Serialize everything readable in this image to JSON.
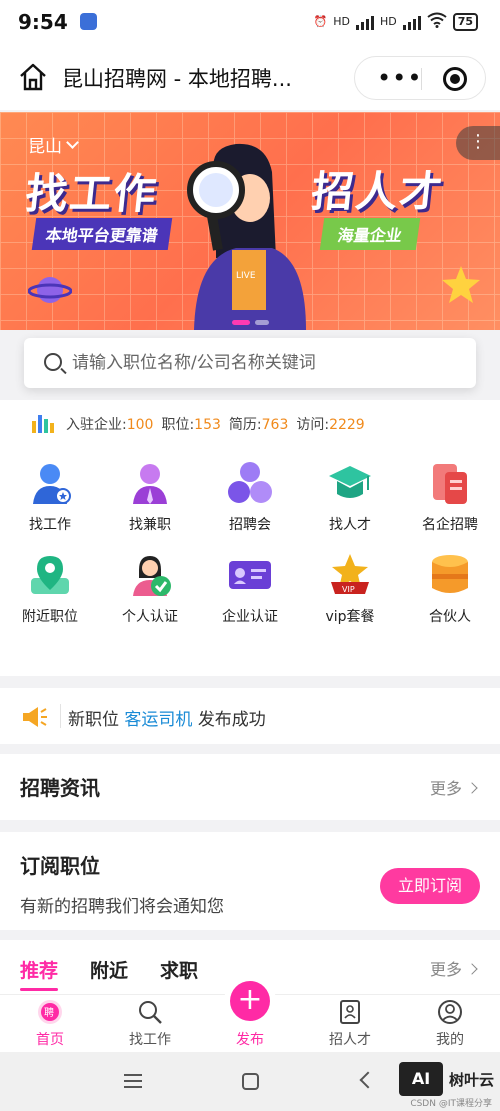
{
  "status": {
    "time": "9:54",
    "battery": "75",
    "signal1": "HD",
    "signal2": "HD"
  },
  "nav": {
    "title": "昆山招聘网 - 本地招聘..."
  },
  "banner": {
    "city": "昆山",
    "headline_left": "找工作",
    "headline_right": "招人才",
    "sub_left": "本地平台更靠谱",
    "sub_right": "海量企业",
    "badge": "LIVE",
    "menu_glyph": "⋮"
  },
  "search": {
    "placeholder": "请输入职位名称/公司名称关键词"
  },
  "stats": {
    "items": [
      {
        "label": "入驻企业:",
        "value": "100"
      },
      {
        "label": "职位:",
        "value": "153"
      },
      {
        "label": "简历:",
        "value": "763"
      },
      {
        "label": "访问:",
        "value": "2229"
      }
    ]
  },
  "grid": [
    {
      "label": "找工作",
      "icon": "job-seeker-icon",
      "color": "#3f7ef0"
    },
    {
      "label": "找兼职",
      "icon": "part-time-icon",
      "color": "#b55ce6"
    },
    {
      "label": "招聘会",
      "icon": "job-fair-icon",
      "color": "#8a63f0"
    },
    {
      "label": "找人才",
      "icon": "graduate-cap-icon",
      "color": "#2ec4a0"
    },
    {
      "label": "名企招聘",
      "icon": "famous-company-icon",
      "color": "#f25d5d"
    },
    {
      "label": "附近职位",
      "icon": "map-pin-icon",
      "color": "#27c08e"
    },
    {
      "label": "个人认证",
      "icon": "personal-verify-icon",
      "color": "#2db86a"
    },
    {
      "label": "企业认证",
      "icon": "company-verify-icon",
      "color": "#7a4de0"
    },
    {
      "label": "vip套餐",
      "icon": "vip-crown-icon",
      "color": "#f2b21c"
    },
    {
      "label": "合伙人",
      "icon": "partner-icon",
      "color": "#f59a2a"
    }
  ],
  "notice": {
    "prefix": "新职位",
    "highlight": "客运司机",
    "suffix": "发布成功"
  },
  "news": {
    "title": "招聘资讯",
    "more": "更多"
  },
  "subscribe": {
    "title": "订阅职位",
    "desc": "有新的招聘我们将会通知您",
    "button": "立即订阅"
  },
  "feed": {
    "tabs": [
      "推荐",
      "附近",
      "求职"
    ],
    "more": "更多"
  },
  "tabbar": [
    {
      "label": "首页",
      "icon": "home-hire-icon"
    },
    {
      "label": "找工作",
      "icon": "search-icon"
    },
    {
      "label": "发布",
      "icon": "plus-icon"
    },
    {
      "label": "招人才",
      "icon": "resume-icon"
    },
    {
      "label": "我的",
      "icon": "user-icon"
    }
  ],
  "watermark": {
    "logo": "AI",
    "text": "树叶云",
    "sub": "CSDN @IT课程分享"
  },
  "colors": {
    "accent": "#ff2aa5",
    "highlight": "#1a8bd6",
    "stat_value": "#f08a1c"
  }
}
